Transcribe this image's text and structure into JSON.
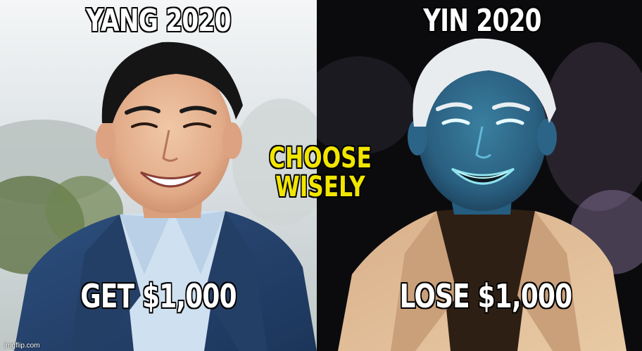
{
  "left_panel": {
    "top_caption": "YANG 2020",
    "bottom_caption": "GET $1,000"
  },
  "right_panel": {
    "top_caption": "YIN 2020",
    "bottom_caption": "LOSE $1,000"
  },
  "center_caption": {
    "line1": "CHOOSE",
    "line2": "WISELY",
    "color": "#f2e600"
  },
  "watermark": "imgflip.com"
}
